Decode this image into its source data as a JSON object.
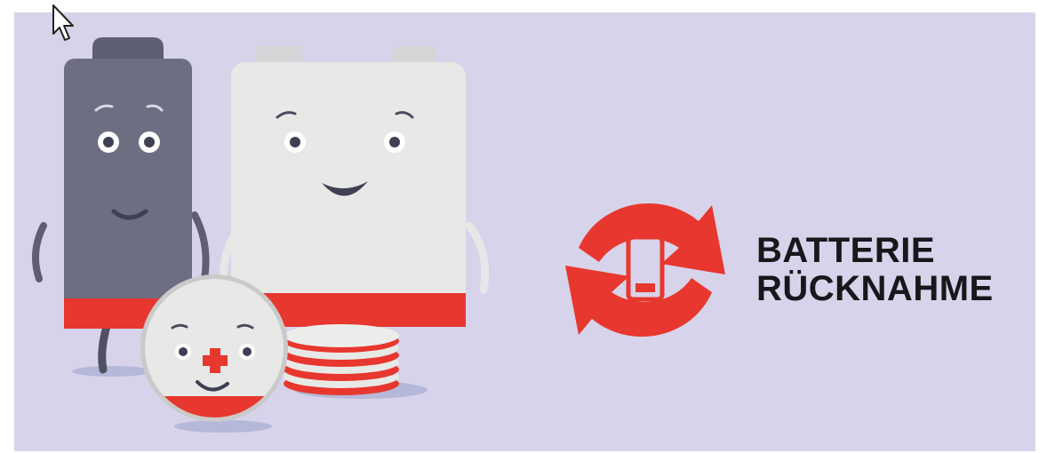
{
  "banner": {
    "title_line1": "BATTERIE",
    "title_line2": "RÜCKNAHME",
    "background_color": "#d7d3ea",
    "accent_color": "#e8372e",
    "text_color": "#17171c"
  },
  "illustration": {
    "characters": [
      "dark-aa-battery",
      "white-square-battery",
      "button-cell-battery",
      "coin-cell-stack"
    ],
    "icons": [
      "recycle-arrows-icon",
      "battery-low-icon",
      "mouse-cursor-icon"
    ]
  }
}
